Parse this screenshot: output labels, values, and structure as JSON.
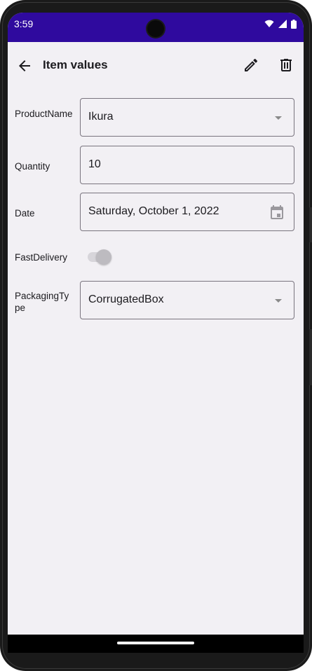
{
  "status_bar": {
    "time": "3:59",
    "background_color": "#2f0a9e",
    "icons": [
      "wifi-icon",
      "cellular-signal-icon",
      "battery-icon"
    ]
  },
  "app_bar": {
    "title": "Item values",
    "back_icon": "arrow-left-icon",
    "edit_icon": "pencil-icon",
    "delete_icon": "trash-icon"
  },
  "form": {
    "product_name": {
      "label": "ProductName",
      "value": "Ikura"
    },
    "quantity": {
      "label": "Quantity",
      "value": "10"
    },
    "date": {
      "label": "Date",
      "value": "Saturday, October 1, 2022"
    },
    "fast_delivery": {
      "label": "FastDelivery",
      "checked": false,
      "enabled": false
    },
    "packaging_type": {
      "label": "PackagingType",
      "value": "CorrugatedBox"
    }
  },
  "colors": {
    "screen_background": "#f2f0f4",
    "text": "#1c1b1f",
    "outline": "#79747e"
  }
}
